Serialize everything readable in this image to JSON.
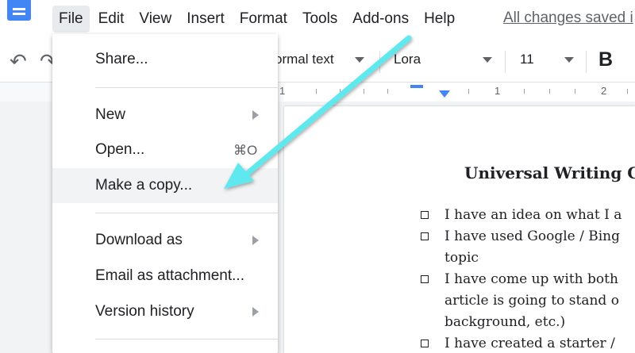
{
  "app": {
    "logo_icon": "docs-logo-icon"
  },
  "menubar": {
    "items": [
      "File",
      "Edit",
      "View",
      "Insert",
      "Format",
      "Tools",
      "Add-ons",
      "Help"
    ],
    "save_status": "All changes saved i"
  },
  "toolbar": {
    "undo_icon": "undo-icon",
    "redo_icon": "redo-icon",
    "style_label": "ormal text",
    "font_label": "Lora",
    "size_label": "11",
    "bold_label": "B"
  },
  "ruler": {
    "labels": [
      "1",
      "1",
      "2"
    ]
  },
  "file_menu": {
    "share": "Share...",
    "new": "New",
    "open": "Open...",
    "open_shortcut": "⌘O",
    "make_copy": "Make a copy...",
    "download_as": "Download as",
    "email_attachment": "Email as attachment...",
    "version_history": "Version history"
  },
  "document": {
    "title": "Universal Writing C",
    "lines": [
      {
        "checkbox": true,
        "text": "I have an idea on what I a"
      },
      {
        "checkbox": true,
        "text": "I have used Google / Bing"
      },
      {
        "checkbox": false,
        "text": "topic"
      },
      {
        "checkbox": true,
        "text": "I have come up with both"
      },
      {
        "checkbox": false,
        "text": "article is going to stand o"
      },
      {
        "checkbox": false,
        "text": "background, etc.)"
      },
      {
        "checkbox": true,
        "text": "I have created a starter /"
      }
    ]
  },
  "colors": {
    "annotation_arrow": "#5ee8ee",
    "accent": "#4285f4",
    "menu_highlight": "#f1f3f4"
  }
}
